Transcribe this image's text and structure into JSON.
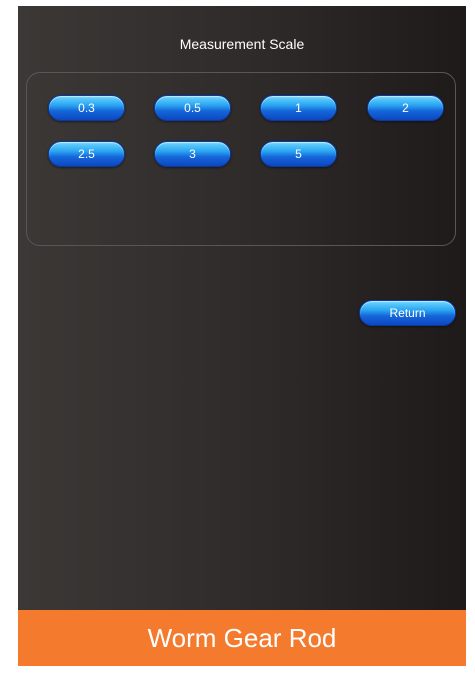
{
  "title": "Measurement Scale",
  "scale_options": [
    "0.3",
    "0.5",
    "1",
    "2",
    "2.5",
    "3",
    "5"
  ],
  "return_label": "Return",
  "footer_label": "Worm Gear Rod",
  "colors": {
    "footer": "#f47a2e",
    "button_blue": "#1666d9",
    "background": "#2e2a29"
  }
}
